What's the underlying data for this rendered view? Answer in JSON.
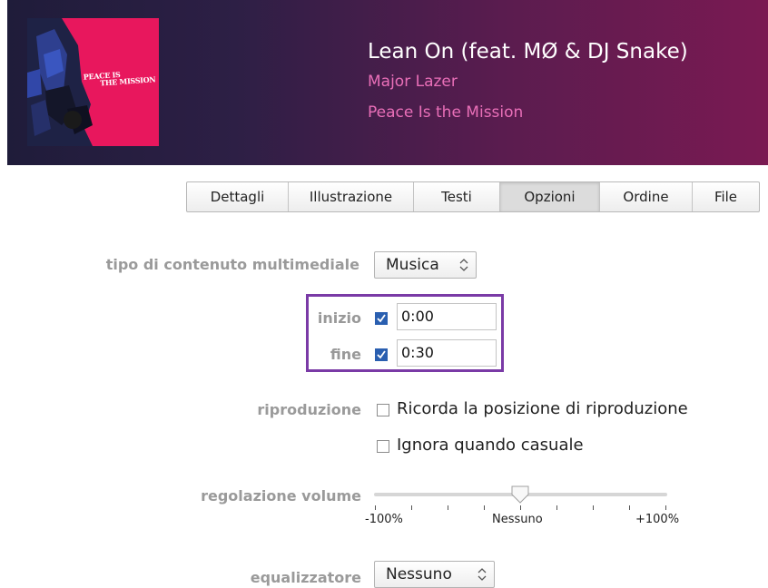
{
  "song": {
    "title": "Lean On (feat. MØ & DJ Snake)",
    "artist": "Major Lazer",
    "album": "Peace Is the Mission",
    "artwork_text_line1": "PEACE IS",
    "artwork_text_line2": "THE MISSION"
  },
  "tabs": [
    {
      "label": "Dettagli",
      "active": false
    },
    {
      "label": "Illustrazione",
      "active": false
    },
    {
      "label": "Testi",
      "active": false
    },
    {
      "label": "Opzioni",
      "active": true
    },
    {
      "label": "Ordine",
      "active": false
    },
    {
      "label": "File",
      "active": false
    }
  ],
  "options": {
    "media_kind_label": "tipo di contenuto multimediale",
    "media_kind_value": "Musica",
    "start_label": "inizio",
    "start_checked": true,
    "start_value": "0:00",
    "stop_label": "fine",
    "stop_checked": true,
    "stop_value": "0:30",
    "playback_label": "riproduzione",
    "remember_position_label": "Ricorda la posizione di riproduzione",
    "remember_position_checked": false,
    "skip_shuffle_label": "Ignora quando casuale",
    "skip_shuffle_checked": false,
    "volume_label": "regolazione volume",
    "volume_min_label": "-100%",
    "volume_mid_label": "Nessuno",
    "volume_max_label": "+100%",
    "volume_value_percent": 0,
    "equalizer_label": "equalizzatore",
    "equalizer_value": "Nessuno"
  },
  "colors": {
    "highlight_box": "#7a3aa6",
    "header_artist_text": "#e96fb8",
    "checkbox_checked": "#2a5fb0"
  }
}
